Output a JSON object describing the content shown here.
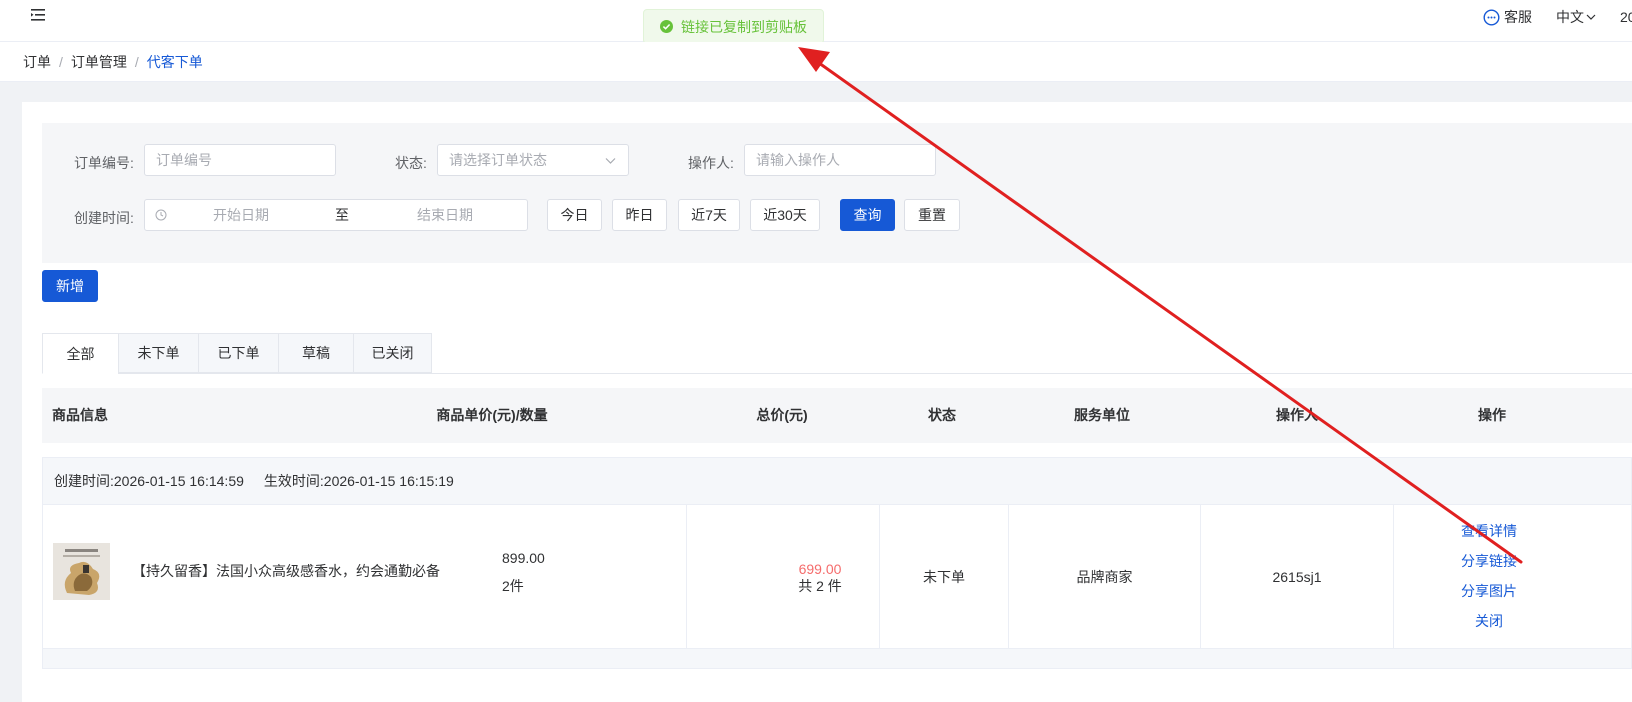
{
  "topbar": {
    "service_label": "客服",
    "language_label": "中文",
    "year_fragment": "20"
  },
  "toast": {
    "message": "链接已复制到剪贴板"
  },
  "breadcrumb": [
    "订单",
    "订单管理",
    "代客下单"
  ],
  "filters": {
    "order_no_label": "订单编号:",
    "order_no_placeholder": "订单编号",
    "status_label": "状态:",
    "status_placeholder": "请选择订单状态",
    "operator_label": "操作人:",
    "operator_placeholder": "请输入操作人",
    "created_label": "创建时间:",
    "start_placeholder": "开始日期",
    "range_to": "至",
    "end_placeholder": "结束日期",
    "quick_ranges": [
      "今日",
      "昨日",
      "近7天",
      "近30天"
    ],
    "query_button": "查询",
    "reset_button": "重置"
  },
  "add_button": "新增",
  "tabs": [
    {
      "label": "全部",
      "active": true
    },
    {
      "label": "未下单",
      "active": false
    },
    {
      "label": "已下单",
      "active": false
    },
    {
      "label": "草稿",
      "active": false
    },
    {
      "label": "已关闭",
      "active": false
    }
  ],
  "table": {
    "headers": {
      "product": "商品信息",
      "unit_price_qty": "商品单价(元)/数量",
      "total": "总价(元)",
      "status": "状态",
      "service_unit": "服务单位",
      "operator": "操作人",
      "actions": "操作"
    },
    "orders": [
      {
        "created": "创建时间:2026-01-15 16:14:59",
        "effective": "生效时间:2026-01-15 16:15:19",
        "product_name": "【持久留香】法国小众高级感香水，约会通勤必备",
        "unit_price": "899.00",
        "quantity": "2件",
        "total": "699.00",
        "total_count": "共 2 件",
        "status": "未下单",
        "service_unit": "品牌商家",
        "operator": "2615sj1",
        "actions": [
          "查看详情",
          "分享链接",
          "分享图片",
          "关闭"
        ]
      }
    ]
  },
  "colors": {
    "primary": "#1659d6",
    "success": "#67c23a",
    "danger_price": "#f56c6c",
    "annotation_arrow": "#e02020"
  }
}
